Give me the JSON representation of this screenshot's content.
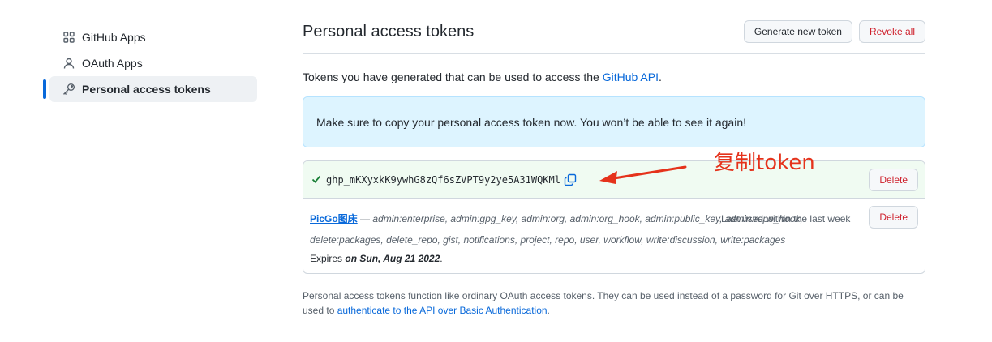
{
  "sidebar": {
    "items": [
      {
        "label": "GitHub Apps",
        "icon": "apps-grid-icon"
      },
      {
        "label": "OAuth Apps",
        "icon": "person-icon"
      },
      {
        "label": "Personal access tokens",
        "icon": "key-icon",
        "active": true
      }
    ]
  },
  "header": {
    "title": "Personal access tokens",
    "generate_label": "Generate new token",
    "revoke_label": "Revoke all"
  },
  "intro": {
    "text": "Tokens you have generated that can be used to access the ",
    "link": "GitHub API",
    "suffix": "."
  },
  "flash": {
    "message": "Make sure to copy your personal access token now. You won’t be able to see it again!"
  },
  "new_token": {
    "value": "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",
    "delete_label": "Delete"
  },
  "token": {
    "name": "PicGo图床",
    "dash": " — ",
    "scopes": "admin:enterprise, admin:gpg_key, admin:org, admin:org_hook, admin:public_key, admin:repo_hook, delete:packages, delete_repo, gist, notifications, project, repo, user, workflow, write:discussion, write:packages",
    "last_used": "Last used within the last week",
    "expires_prefix": "Expires ",
    "expires_date": "on Sun, Aug 21 2022",
    "expires_suffix": ".",
    "delete_label": "Delete"
  },
  "footnote": {
    "text": "Personal access tokens function like ordinary OAuth access tokens. They can be used instead of a password for Git over HTTPS, or can be used to ",
    "link": "authenticate to the API over Basic Authentication",
    "suffix": "."
  },
  "annotation": {
    "text": "复制token",
    "color": "#e5321b"
  },
  "colors": {
    "accent": "#0969da",
    "danger": "#cf222e",
    "success": "#1a7f37",
    "flash_bg": "#ddf4ff"
  }
}
